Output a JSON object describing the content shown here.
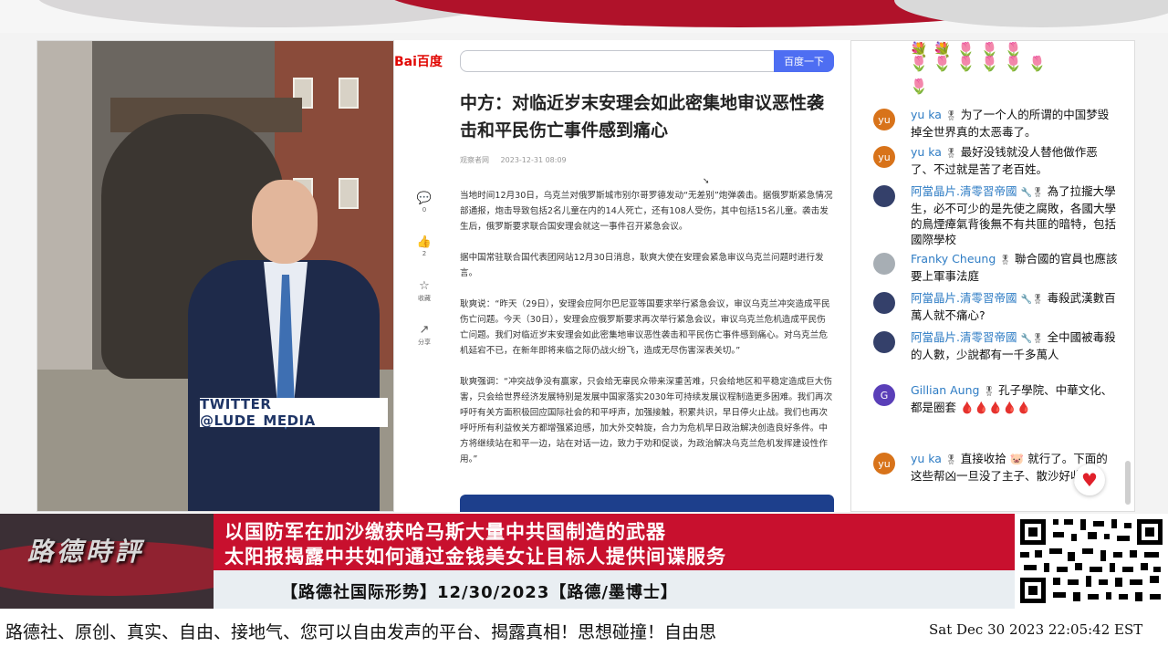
{
  "video": {
    "twitter_tag": "TWITTER  @LUDE_MEDIA"
  },
  "article": {
    "baidu_logo": "Bai百度",
    "search_button": "百度一下",
    "title": "中方：对临近岁末安理会如此密集地审议恶性袭击和平民伤亡事件感到痛心",
    "source": "观察者网",
    "time": "2023-12-31 08:09",
    "actions": [
      {
        "icon": "comment-icon",
        "glyph": "💬",
        "label": "0"
      },
      {
        "icon": "thumbs-up-icon",
        "glyph": "👍",
        "label": "2"
      },
      {
        "icon": "star-icon",
        "glyph": "☆",
        "label": "收藏"
      },
      {
        "icon": "share-icon",
        "glyph": "↗",
        "label": "分享"
      }
    ],
    "paragraphs": [
      "当地时间12月30日，乌克兰对俄罗斯城市别尔哥罗德发动“无差别”炮弹袭击。据俄罗斯紧急情况部通报，炮击导致包括2名儿童在内的14人死亡，还有108人受伤，其中包括15名儿童。袭击发生后，俄罗斯要求联合国安理会就这一事件召开紧急会议。",
      "据中国常驻联合国代表团网站12月30日消息，耿爽大使在安理会紧急审议乌克兰问题时进行发言。",
      "耿爽说：“昨天（29日），安理会应阿尔巴尼亚等国要求举行紧急会议，审议乌克兰冲突造成平民伤亡问题。今天（30日），安理会应俄罗斯要求再次举行紧急会议，审议乌克兰危机造成平民伤亡问题。我们对临近岁末安理会如此密集地审议恶性袭击和平民伤亡事件感到痛心。对乌克兰危机延宕不已，在新年即将来临之际仍战火纷飞，造成无尽伤害深表关切。”",
      "耿爽强调：“冲突战争没有赢家，只会给无辜民众带来深重苦难，只会给地区和平稳定造成巨大伤害，只会给世界经济发展特别是发展中国家落实2030年可持续发展议程制造更多困难。我们再次呼吁有关方面积极回应国际社会的和平呼声，加强接触，积累共识，早日停火止战。我们也再次呼吁所有利益攸关方都增强紧迫感，加大外交斡旋，合力为危机早日政治解决创造良好条件。中方将继续站在和平一边，站在对话一边，致力于劝和促谈，为政治解决乌克兰危机发挥建设性作用。”"
    ]
  },
  "chat": {
    "emoji_row_1": "💐💐🌷🌷🌷",
    "emoji_row_2": "🌷🌷🌷🌷🌷🌷",
    "emoji_row_3": "🌷",
    "messages": [
      {
        "avatar": "yu",
        "avatar_color": "#d8731a",
        "author": "yu ka",
        "badge": "🎖",
        "text": "为了一个人的所谓的中国梦毁掉全世界真的太恶毒了。"
      },
      {
        "avatar": "yu",
        "avatar_color": "#d8731a",
        "author": "yu ka",
        "badge": "🎖",
        "text": "最好没钱就没人替他做作恶了、不过就是苦了老百姓。"
      },
      {
        "avatar": "",
        "avatar_color": "#34406a",
        "author": "阿當晶片.清零習帝國",
        "badge": "🔧🎖",
        "text": "為了拉攏大學生，必不可少的是先使之腐敗，各國大學的鳥煙瘴氣背後無不有共匪的暗特，包括國際學校"
      },
      {
        "avatar": "",
        "avatar_color": "#a7aeb4",
        "author": "Franky Cheung",
        "badge": "🎖",
        "text": "聯合國的官員也應該要上軍事法庭"
      },
      {
        "avatar": "",
        "avatar_color": "#34406a",
        "author": "阿當晶片.清零習帝國",
        "badge": "🔧🎖",
        "text": "毒殺武漢數百萬人就不痛心?"
      },
      {
        "avatar": "",
        "avatar_color": "#34406a",
        "author": "阿當晶片.清零習帝國",
        "badge": "🔧🎖",
        "text": "全中國被毒殺的人數，少說都有一千多萬人"
      },
      {
        "avatar": "G",
        "avatar_color": "#5a3fb8",
        "author": "Gillian Aung",
        "badge": "🎖",
        "text": "孔子學院、中華文化、都是圈套 🩸🩸🩸🩸🩸"
      },
      {
        "avatar": "yu",
        "avatar_color": "#d8731a",
        "author": "yu ka",
        "badge": "🎖",
        "text": "直接收拾 🐷 就行了。下面的这些帮凶一旦没了主子、散沙好收拾。"
      }
    ]
  },
  "lower_third": {
    "logo_text": "路德時評",
    "headline_1": "以国防军在加沙缴获哈马斯大量中共国制造的武器",
    "headline_2": "太阳报揭露中共如何通过金钱美女让目标人提供间谍服务",
    "program": "【路德社国际形势】12/30/2023【路德/墨博士】"
  },
  "ticker": {
    "text": "路德社、原创、真实、自由、接地气、您可以自由发声的平台、揭露真相！思想碰撞！自由思",
    "time": "Sat Dec 30 2023 22:05:42 EST"
  },
  "colors": {
    "headline_red": "#c8102e",
    "baidu_blue": "#4e6ef2",
    "chat_author_blue": "#2e7cc4"
  }
}
